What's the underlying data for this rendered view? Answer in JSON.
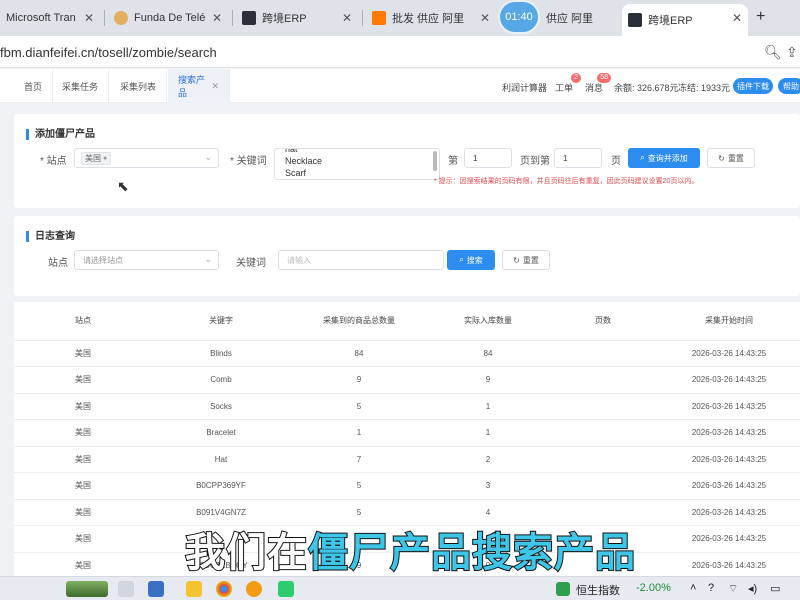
{
  "browser": {
    "tabs": [
      {
        "title": "Microsoft Tran",
        "active": false
      },
      {
        "title": "Funda De Telé",
        "active": false
      },
      {
        "title": "跨境ERP",
        "active": false
      },
      {
        "title": "批发 供应 阿里",
        "active": false
      },
      {
        "title": "供应 阿里",
        "active": false
      },
      {
        "title": "跨境ERP",
        "active": true
      }
    ],
    "timer": "01:40",
    "new_tab": "+",
    "url": "fbm.dianfeifei.cn/tosell/zombie/search"
  },
  "nav": {
    "tabs": [
      "首页",
      "采集任务",
      "采集列表",
      "搜索产品"
    ],
    "profit_calc": "利润计算器",
    "work_order": "工单",
    "work_order_count": "2",
    "messages": "消息",
    "messages_count": "58",
    "balance": "余额: 326.678元",
    "frozen": "冻结: 1933元",
    "plugin_download": "插件下载",
    "help": "帮助"
  },
  "add_section": {
    "title": "添加僵尸产品",
    "site_label": "* 站点",
    "site_value": "美国",
    "keyword_label": "* 关键词",
    "keywords": [
      "hat",
      "Necklace",
      "Scarf"
    ],
    "page_label_prefix": "第",
    "page_from": "1",
    "page_label_mid": "页到第",
    "page_to": "1",
    "page_label_suffix": "页",
    "query_add_button": "查询并添加",
    "reset_button": "重置",
    "hint": "* 提示：因搜索结果的页码有限，并且页码往后有重复，因此页码建议设置20页以内。"
  },
  "log_section": {
    "title": "日志查询",
    "site_label": "站点",
    "site_placeholder": "请选择站点",
    "keyword_label": "关键词",
    "keyword_placeholder": "请输入",
    "search_button": "搜索",
    "reset_button": "重置"
  },
  "table": {
    "columns": [
      "站点",
      "关键字",
      "采集到的商品总数量",
      "实际入库数量",
      "页数",
      "采集开始时间"
    ],
    "rows": [
      [
        "美国",
        "Blinds",
        "84",
        "84",
        "",
        "2026-03-26 14:43:25"
      ],
      [
        "美国",
        "Comb",
        "9",
        "9",
        "",
        "2026-03-26 14:43:25"
      ],
      [
        "美国",
        "Socks",
        "5",
        "1",
        "",
        "2026-03-26 14:43:25"
      ],
      [
        "美国",
        "Bracelet",
        "1",
        "1",
        "",
        "2026-03-26 14:43:25"
      ],
      [
        "美国",
        "Hat",
        "7",
        "2",
        "",
        "2026-03-26 14:43:25"
      ],
      [
        "美国",
        "B0CPP369YF",
        "5",
        "3",
        "",
        "2026-03-26 14:43:25"
      ],
      [
        "美国",
        "B091V4GN7Z",
        "5",
        "4",
        "",
        "2026-03-26 14:43:25"
      ],
      [
        "美国",
        "",
        "",
        "",
        "",
        "2026-03-26 14:43:25"
      ],
      [
        "美国",
        "B0DCJRBSQY",
        "9",
        "0",
        "",
        "2026-03-26 14:43:25"
      ]
    ]
  },
  "subtitle": {
    "plain": "我们在",
    "highlight": "僵尸产品搜索产品"
  },
  "taskbar": {
    "stock_name": "恒生指数",
    "stock_change": "-2.00%"
  },
  "colors": {
    "accent": "#2d8cf0",
    "hint": "#e2474c",
    "subtitle_highlight": "#3ec6e8",
    "badge": "#f56c6c"
  }
}
